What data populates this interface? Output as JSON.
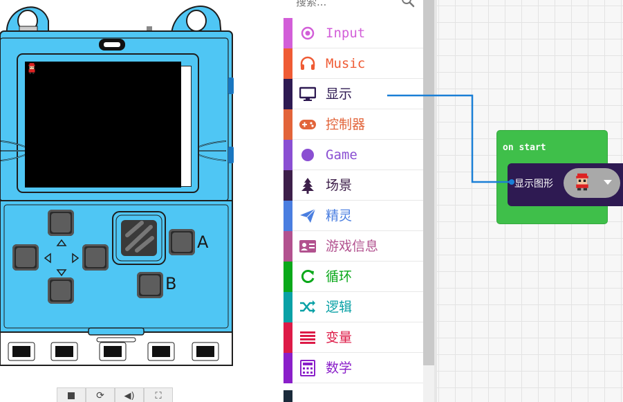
{
  "search": {
    "placeholder": "搜索..."
  },
  "categories": [
    {
      "label": "Input",
      "color": "#d25ed8",
      "icon": "target-icon",
      "mono": true
    },
    {
      "label": "Music",
      "color": "#ef5b34",
      "icon": "headphones-icon",
      "mono": true
    },
    {
      "label": "显示",
      "color": "#2e1a52",
      "icon": "monitor-icon",
      "mono": false
    },
    {
      "label": "控制器",
      "color": "#e2643a",
      "icon": "gamepad-icon",
      "mono": false
    },
    {
      "label": "Game",
      "color": "#8a4fd2",
      "icon": "circle-icon",
      "mono": true
    },
    {
      "label": "场景",
      "color": "#3d1f4a",
      "icon": "tree-icon",
      "mono": false
    },
    {
      "label": "精灵",
      "color": "#4a7ee0",
      "icon": "paper-plane-icon",
      "mono": false
    },
    {
      "label": "游戏信息",
      "color": "#b2528f",
      "icon": "id-card-icon",
      "mono": false
    },
    {
      "label": "循环",
      "color": "#0aa81a",
      "icon": "refresh-icon",
      "mono": false
    },
    {
      "label": "逻辑",
      "color": "#0aa1a6",
      "icon": "shuffle-icon",
      "mono": false
    },
    {
      "label": "变量",
      "color": "#dd1b47",
      "icon": "list-icon",
      "mono": false
    },
    {
      "label": "数学",
      "color": "#8a1fc9",
      "icon": "calculator-icon",
      "mono": false
    }
  ],
  "workspace": {
    "on_start_label": "on start",
    "show_block_label": "显示图形"
  },
  "device": {
    "button_a": "A",
    "button_b": "B"
  },
  "sim_toolbar": [
    "stop-icon",
    "restart-icon",
    "volume-icon",
    "fullscreen-icon"
  ]
}
